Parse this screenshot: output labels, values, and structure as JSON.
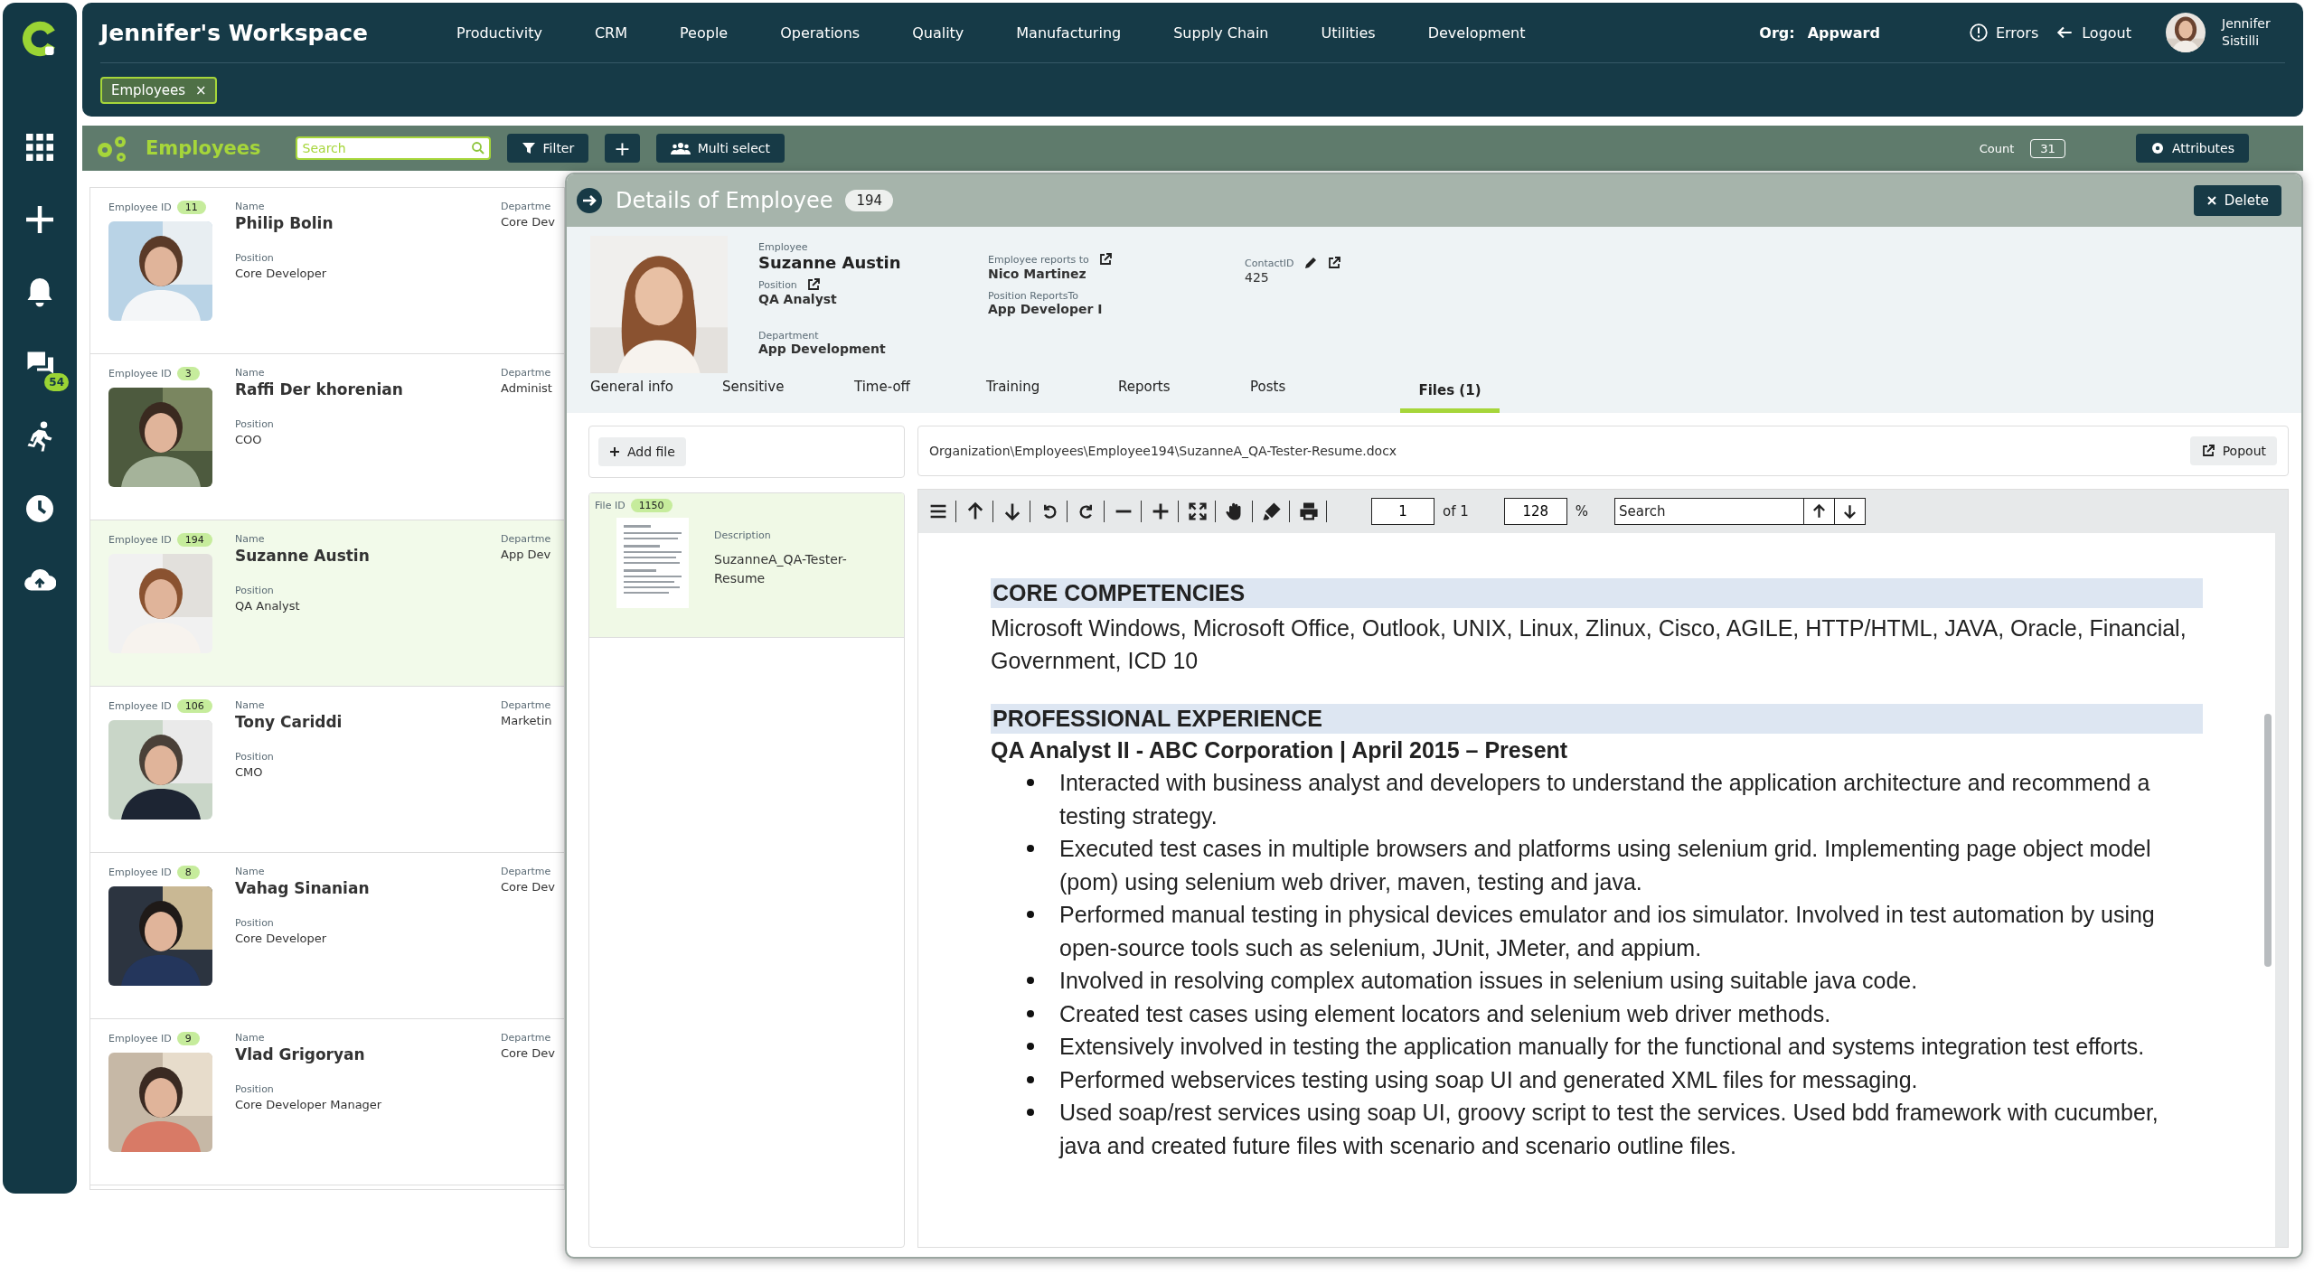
{
  "sidebar": {
    "chat_badge": "54"
  },
  "topbar": {
    "title": "Jennifer's Workspace",
    "nav": [
      "Productivity",
      "CRM",
      "People",
      "Operations",
      "Quality",
      "Manufacturing",
      "Supply Chain",
      "Utilities",
      "Development"
    ],
    "org_label": "Org:",
    "org": "Appward",
    "errors": "Errors",
    "logout": "Logout",
    "user": "Jennifer Sistilli"
  },
  "open_tabs": [
    {
      "label": "Employees",
      "close": "×"
    }
  ],
  "toolbar": {
    "title": "Employees",
    "search_placeholder": "Search",
    "filter": "Filter",
    "add": "+",
    "multi_select": "Multi select",
    "count_label": "Count",
    "count": "31",
    "attributes": "Attributes"
  },
  "employees": [
    {
      "id_label": "Employee ID",
      "id": "11",
      "name_label": "Name",
      "name": "Philip Bolin",
      "position_label": "Position",
      "position": "Core Developer",
      "department_label": "Departme",
      "department": "Core Dev",
      "selected": false
    },
    {
      "id_label": "Employee ID",
      "id": "3",
      "name_label": "Name",
      "name": "Raffi Der khorenian",
      "position_label": "Position",
      "position": "COO",
      "department_label": "Departme",
      "department": "Administ",
      "selected": false
    },
    {
      "id_label": "Employee ID",
      "id": "194",
      "name_label": "Name",
      "name": "Suzanne Austin",
      "position_label": "Position",
      "position": "QA Analyst",
      "department_label": "Departme",
      "department": "App Dev",
      "selected": true
    },
    {
      "id_label": "Employee ID",
      "id": "106",
      "name_label": "Name",
      "name": "Tony Cariddi",
      "position_label": "Position",
      "position": "CMO",
      "department_label": "Departme",
      "department": "Marketin",
      "selected": false
    },
    {
      "id_label": "Employee ID",
      "id": "8",
      "name_label": "Name",
      "name": "Vahag Sinanian",
      "position_label": "Position",
      "position": "Core Developer",
      "department_label": "Departme",
      "department": "Core Dev",
      "selected": false
    },
    {
      "id_label": "Employee ID",
      "id": "9",
      "name_label": "Name",
      "name": "Vlad Grigoryan",
      "position_label": "Position",
      "position": "Core Developer Manager",
      "department_label": "Departme",
      "department": "Core Dev",
      "selected": false
    }
  ],
  "details": {
    "title": "Details of Employee",
    "count": "194",
    "delete": "Delete",
    "employee": {
      "label": "Employee",
      "value": "Suzanne Austin"
    },
    "position": {
      "label": "Position",
      "value": "QA Analyst"
    },
    "department": {
      "label": "Department",
      "value": "App Development"
    },
    "reports_to": {
      "label": "Employee reports to",
      "value": "Nico Martinez"
    },
    "position_reports_to": {
      "label": "Position ReportsTo",
      "value": "App Developer I"
    },
    "contact": {
      "label": "ContactID",
      "value": "425"
    },
    "tabs": [
      {
        "label": "General info",
        "selected": false
      },
      {
        "label": "Sensitive",
        "selected": false
      },
      {
        "label": "Time-off",
        "selected": false
      },
      {
        "label": "Training",
        "selected": false
      },
      {
        "label": "Reports",
        "selected": false
      },
      {
        "label": "Posts",
        "selected": false
      },
      {
        "label": "Files (1)",
        "selected": true
      }
    ],
    "add_file": "Add file",
    "files": [
      {
        "id_label": "File ID",
        "id": "1150",
        "description_label": "Description",
        "description": "SuzanneA_QA-Tester-Resume",
        "selected": true
      }
    ],
    "path": "Organization\\Employees\\Employee194\\SuzanneA_QA-Tester-Resume.docx",
    "popout": "Popout",
    "viewer": {
      "page": "1",
      "of": "of 1",
      "zoom": "128",
      "percent": "%",
      "search_placeholder": "Search"
    },
    "document": [
      {
        "heading": "CORE COMPETENCIES",
        "paragraph": "Microsoft Windows, Microsoft Office, Outlook, UNIX, Linux, Zlinux, Cisco, AGILE, HTTP/HTML, JAVA, Oracle, Financial, Government, ICD 10"
      },
      {
        "heading": "PROFESSIONAL EXPERIENCE",
        "subheading": "QA Analyst II - ABC Corporation | April 2015 – Present",
        "bullets": [
          "Interacted with business analyst and developers to understand the application architecture and recommend a testing strategy.",
          "Executed test cases in multiple browsers and platforms using selenium grid. Implementing page object model (pom) using selenium web driver, maven, testing and java.",
          "Performed manual testing in physical devices emulator and ios simulator. Involved in test automation by using open-source tools such as selenium, JUnit, JMeter, and appium.",
          "Involved in resolving complex automation issues in selenium using suitable java code.",
          "Created test cases using element locators and selenium web driver methods.",
          "Extensively involved in testing the application manually for the functional and systems integration test efforts.",
          "Performed webservices testing using soap UI and generated XML files for messaging.",
          "Used soap/rest services using soap UI, groovy script to test the services. Used bdd framework with cucumber, java and created future files with scenario and scenario outline files."
        ]
      }
    ]
  }
}
